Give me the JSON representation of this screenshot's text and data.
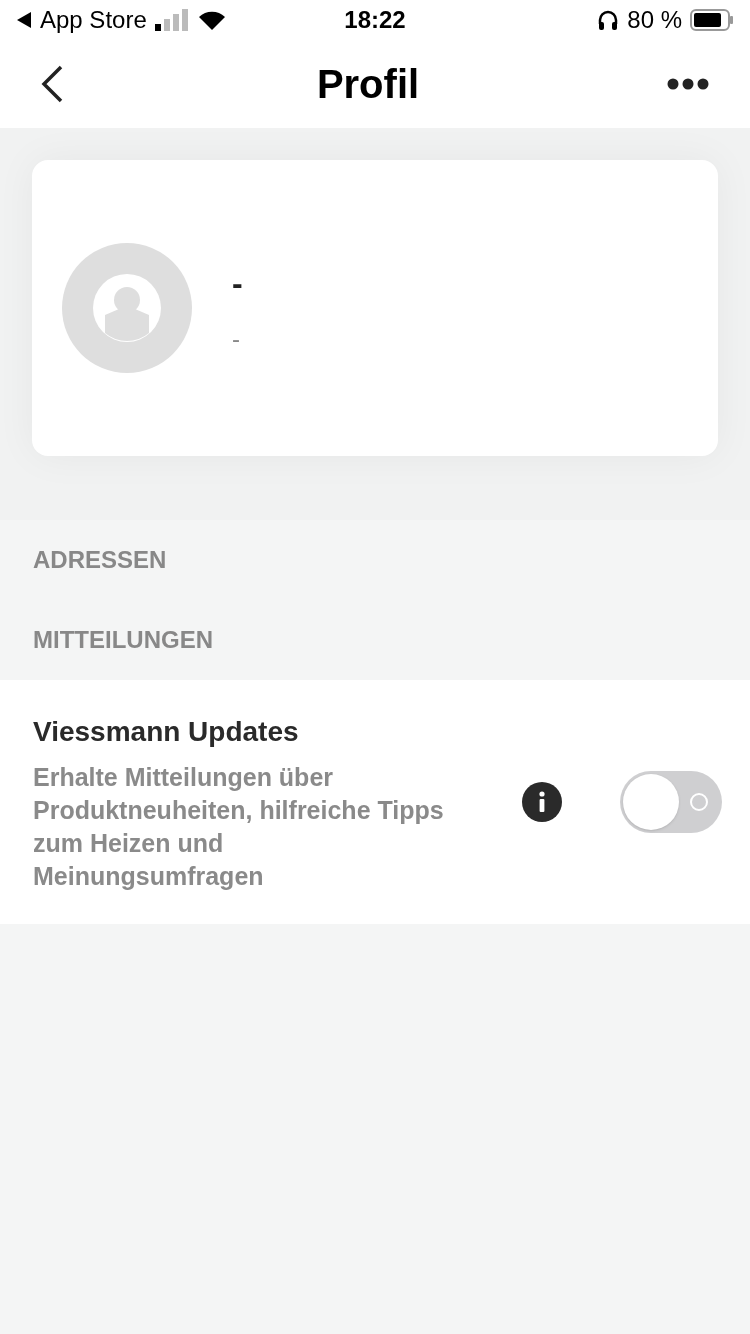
{
  "status_bar": {
    "back_app": "App Store",
    "time": "18:22",
    "battery": "80 %"
  },
  "nav": {
    "title": "Profil"
  },
  "profile": {
    "name": "-",
    "subtitle": "-"
  },
  "sections": [
    {
      "title": "ADRESSEN"
    },
    {
      "title": "MITTEILUNGEN"
    }
  ],
  "notifications": [
    {
      "title": "Viessmann Updates",
      "description": "Erhalte Mitteilungen über Produktneuheiten, hilfreiche Tipps zum Heizen und Meinungsumfragen",
      "on": false
    }
  ]
}
